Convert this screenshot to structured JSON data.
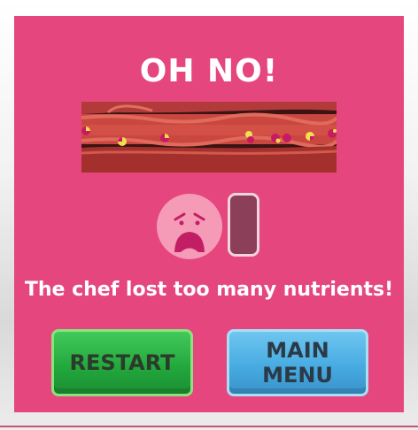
{
  "title": "OH NO!",
  "message": "The chef lost too many nutrients!",
  "buttons": {
    "restart_label": "RESTART",
    "main_menu_label": "MAIN\nMENU"
  },
  "nutrient_meter": {
    "level": 0.0
  },
  "face": {
    "mood": "sad-face-icon",
    "color": "#f59bb8"
  },
  "colors": {
    "panel": "#e5467d",
    "restart": "#21a63c",
    "main_menu": "#45a9e0",
    "meter_empty": "#8b3f58"
  }
}
